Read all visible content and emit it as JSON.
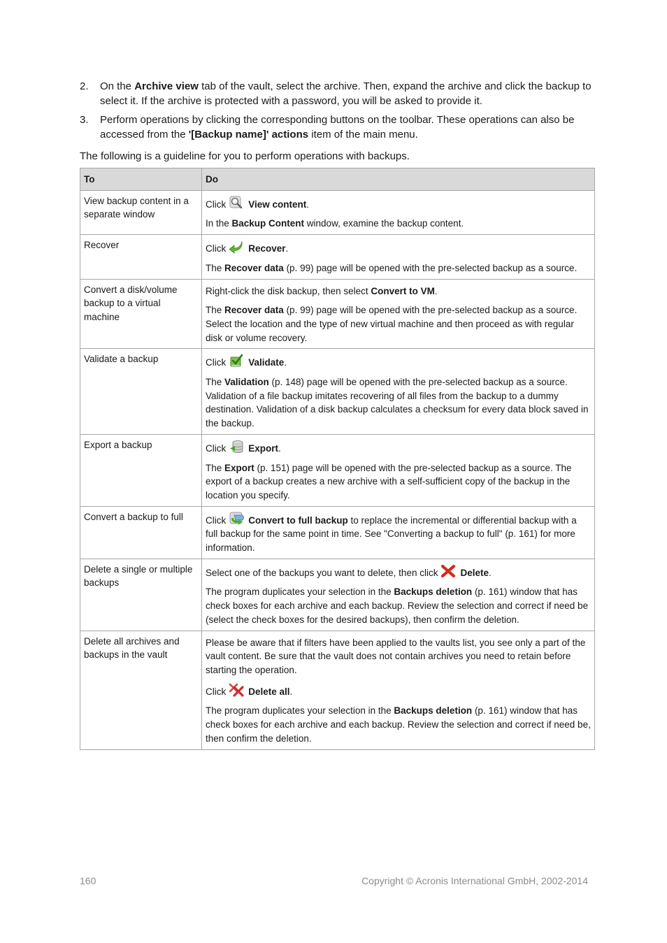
{
  "steps": [
    {
      "num": "2.",
      "parts": [
        "On the ",
        "Archive view",
        " tab of the vault, select the archive. Then, expand the archive and click the backup to select it. If the archive is protected with a password, you will be asked to provide it."
      ]
    },
    {
      "num": "3.",
      "parts": [
        "Perform operations by clicking the corresponding buttons on the toolbar. These operations can also be accessed from the ",
        "'[Backup name]' actions",
        " item of the main menu."
      ]
    }
  ],
  "intro": "The following is a guideline for you to perform operations with backups.",
  "table": {
    "headers": {
      "to": "To",
      "do": "Do"
    },
    "rows": [
      {
        "to": "View backup content in a separate window",
        "do": [
          {
            "pre": "Click",
            "icon": "magnifier-icon",
            "bold": "View content",
            "post": "."
          },
          {
            "pre": "In the ",
            "bold": "Backup Content",
            "post": " window, examine the backup content."
          }
        ]
      },
      {
        "to": "Recover",
        "do": [
          {
            "pre": "Click",
            "icon": "recover-arrow-icon",
            "bold": "Recover",
            "post": "."
          },
          {
            "pre": "The ",
            "bold": "Recover data",
            "post": " (p. 99) page will be opened with the pre-selected backup as a source."
          }
        ]
      },
      {
        "to": "Convert a disk/volume backup to a virtual machine",
        "do": [
          {
            "pre": "Right-click the disk backup, then select ",
            "bold": "Convert to VM",
            "post": "."
          },
          {
            "pre": "The ",
            "bold": "Recover data",
            "post": " (p. 99) page will be opened with the pre-selected backup as a source. Select the location and the type of new virtual machine and then proceed as with regular disk or volume recovery."
          }
        ]
      },
      {
        "to": "Validate a backup",
        "do": [
          {
            "pre": "Click",
            "icon": "validate-check-icon",
            "bold": "Validate",
            "post": "."
          },
          {
            "pre": "The ",
            "bold": "Validation",
            "post": " (p. 148) page will be opened with the pre-selected backup as a source. Validation of a file backup imitates recovering of all files from the backup to a dummy destination. Validation of a disk backup calculates a checksum for every data block saved in the backup."
          }
        ]
      },
      {
        "to": "Export a backup",
        "do": [
          {
            "pre": "Click",
            "icon": "export-database-icon",
            "bold": "Export",
            "post": "."
          },
          {
            "pre": "The ",
            "bold": "Export",
            "post": " (p. 151) page will be opened with the pre-selected backup as a source. The export of a backup creates a new archive with a self-sufficient copy of the backup in the location you specify."
          }
        ]
      },
      {
        "to": "Convert a backup to full",
        "do": [
          {
            "pre": "Click",
            "icon": "convert-full-icon",
            "bold": "Convert to full backup",
            "post": " to replace the incremental or differential backup with a full backup for the same point in time. See \"Converting a backup to full\" (p. 161) for more information."
          }
        ]
      },
      {
        "to": "Delete a single or multiple backups",
        "do": [
          {
            "pre": "Select one of the backups you want to delete, then click",
            "icon": "delete-x-icon",
            "bold": "Delete",
            "post": "."
          },
          {
            "pre": "The program duplicates your selection in the ",
            "bold": "Backups deletion",
            "post": " (p. 161) window that has check boxes for each archive and each backup. Review the selection and correct if need be (select the check boxes for the desired backups), then confirm the deletion."
          }
        ]
      },
      {
        "to": "Delete all archives and backups in the vault",
        "do": [
          {
            "pre": "Please be aware that if filters have been applied to the vaults list, you see only a part of the vault content. Be sure that the vault does not contain archives you need to retain before starting the operation."
          },
          {
            "pre": "Click",
            "icon": "delete-all-icon",
            "bold": "Delete all",
            "post": "."
          },
          {
            "pre": "The program duplicates your selection in the ",
            "bold": "Backups deletion",
            "post": " (p. 161) window that has check boxes for each archive and each backup. Review the selection and correct if need be, then confirm the deletion."
          }
        ]
      }
    ]
  },
  "footer": {
    "page_number": "160",
    "copyright": "Copyright © Acronis International GmbH, 2002-2014"
  }
}
